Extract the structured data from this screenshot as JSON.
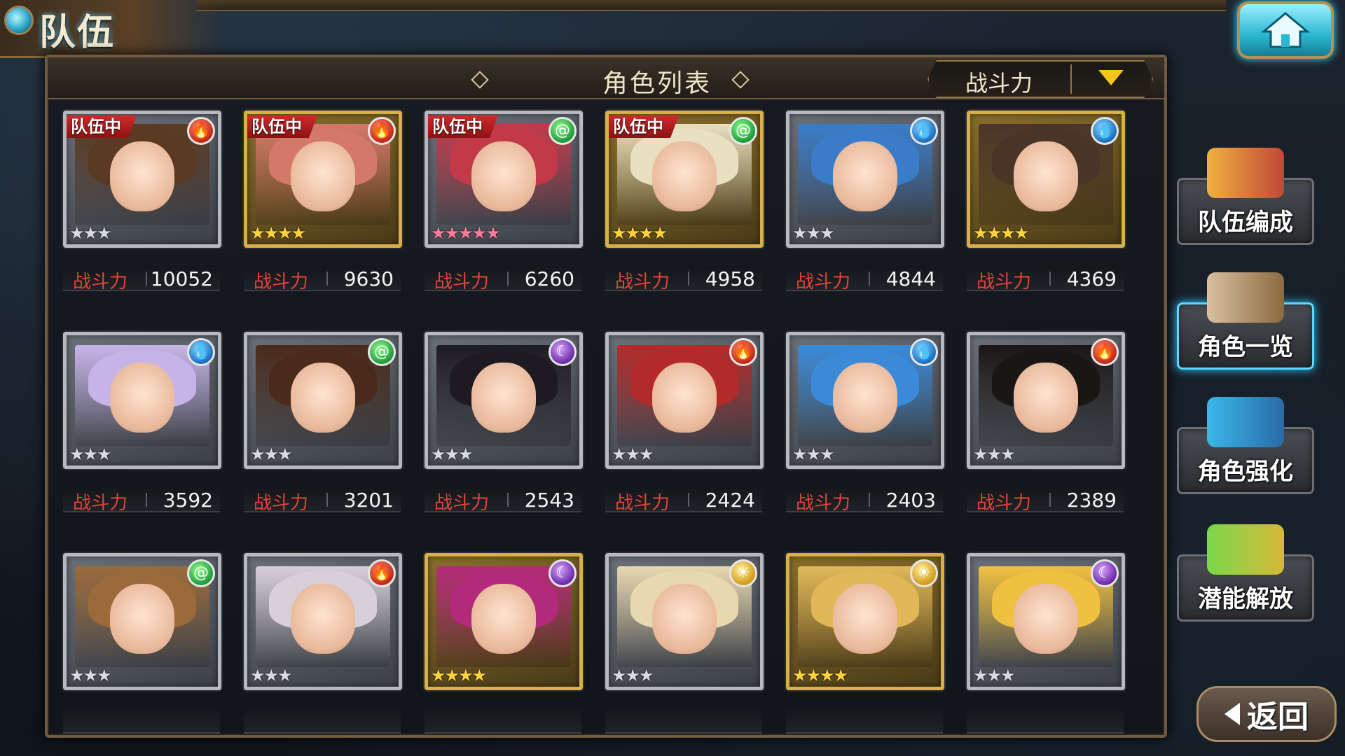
{
  "screen": {
    "title": "队伍"
  },
  "panel": {
    "title": "角色列表",
    "sort_label": "战斗力"
  },
  "power_label": "战斗力",
  "team_badge": "队伍中",
  "colors": {
    "fire": "#c2281a",
    "wind": "#1e9a3a",
    "water": "#1a6ec2",
    "dark": "#6a2aa8",
    "light": "#d49a18",
    "power_label": "#e2453a"
  },
  "characters": [
    {
      "in_team": true,
      "element": "fire",
      "rarity": 3,
      "frame": "silver",
      "power": "10052",
      "hair": "#5a3a22"
    },
    {
      "in_team": true,
      "element": "fire",
      "rarity": 4,
      "frame": "gold",
      "power": "9630",
      "hair": "#d4786a"
    },
    {
      "in_team": true,
      "element": "wind",
      "rarity": 5,
      "frame": "silver",
      "power": "6260",
      "hair": "#c23a4a"
    },
    {
      "in_team": true,
      "element": "wind",
      "rarity": 4,
      "frame": "gold",
      "power": "4958",
      "hair": "#e8e0c0"
    },
    {
      "in_team": false,
      "element": "water",
      "rarity": 3,
      "frame": "silver",
      "power": "4844",
      "hair": "#3a7cc8"
    },
    {
      "in_team": false,
      "element": "water",
      "rarity": 4,
      "frame": "gold",
      "power": "4369",
      "hair": "#4a3428"
    },
    {
      "in_team": false,
      "element": "water",
      "rarity": 3,
      "frame": "silver",
      "power": "3592",
      "hair": "#c6b4e8"
    },
    {
      "in_team": false,
      "element": "wind",
      "rarity": 3,
      "frame": "silver",
      "power": "3201",
      "hair": "#4a2a1a"
    },
    {
      "in_team": false,
      "element": "dark",
      "rarity": 3,
      "frame": "silver",
      "power": "2543",
      "hair": "#1e1a22"
    },
    {
      "in_team": false,
      "element": "fire",
      "rarity": 3,
      "frame": "silver",
      "power": "2424",
      "hair": "#b42a2a"
    },
    {
      "in_team": false,
      "element": "water",
      "rarity": 3,
      "frame": "silver",
      "power": "2403",
      "hair": "#3a8ad8"
    },
    {
      "in_team": false,
      "element": "fire",
      "rarity": 3,
      "frame": "silver",
      "power": "2389",
      "hair": "#1a1616"
    },
    {
      "in_team": false,
      "element": "wind",
      "rarity": 3,
      "frame": "silver",
      "power": "",
      "hair": "#9a6a3a"
    },
    {
      "in_team": false,
      "element": "fire",
      "rarity": 3,
      "frame": "silver",
      "power": "",
      "hair": "#d8d0d8"
    },
    {
      "in_team": false,
      "element": "dark",
      "rarity": 4,
      "frame": "gold",
      "power": "",
      "hair": "#b42a7a"
    },
    {
      "in_team": false,
      "element": "light",
      "rarity": 3,
      "frame": "silver",
      "power": "",
      "hair": "#e8d8b0"
    },
    {
      "in_team": false,
      "element": "light",
      "rarity": 4,
      "frame": "gold",
      "power": "",
      "hair": "#e0b85a"
    },
    {
      "in_team": false,
      "element": "dark",
      "rarity": 3,
      "frame": "silver",
      "power": "",
      "hair": "#f0c040"
    }
  ],
  "side_menu": [
    {
      "label": "队伍编成",
      "active": false
    },
    {
      "label": "角色一览",
      "active": true
    },
    {
      "label": "角色强化",
      "active": false
    },
    {
      "label": "潜能解放",
      "active": false
    }
  ],
  "back_label": "返回"
}
